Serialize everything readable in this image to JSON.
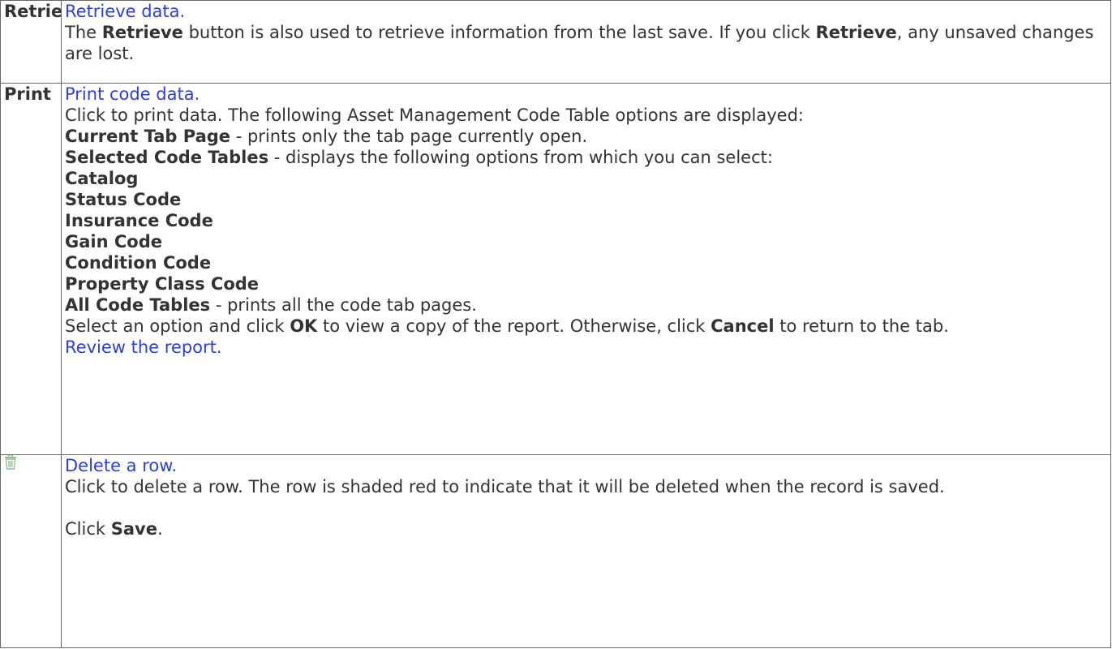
{
  "rows": [
    {
      "label": "Retrieve",
      "link": "Retrieve data.",
      "desc_before": "The ",
      "desc_bold": "Retrieve",
      "desc_mid": " button is also used to retrieve information from the last save. If you click ",
      "desc_bold2": "Retrieve",
      "desc_after": ", any unsaved changes are lost."
    },
    {
      "label": "Print",
      "link": "Print code data.",
      "intro": "Click to print data. The following Asset Management Code Table options are displayed:",
      "opt1_bold": "Current Tab Page",
      "opt1_text": " - prints only the tab page currently open.",
      "opt2_bold": "Selected Code Tables",
      "opt2_text": " - displays the following options from which you can select:",
      "tables": [
        "Catalog",
        "Status Code",
        "Insurance Code",
        "Gain Code",
        "Condition Code",
        "Property Class Code"
      ],
      "opt3_bold": "All Code Tables",
      "opt3_text": " - prints all the code tab pages.",
      "select_before": "Select an option and click ",
      "select_ok": "OK",
      "select_mid": " to view a copy of the report. Otherwise, click ",
      "select_cancel": "Cancel",
      "select_after": " to return to the tab.",
      "review_link": "Review the report."
    },
    {
      "icon": "trash-icon",
      "link": "Delete a row.",
      "desc": "Click to delete a row. The row is shaded red to indicate that it will be deleted when the record is saved.",
      "save_before": "Click ",
      "save_bold": "Save",
      "save_after": "."
    }
  ],
  "colors": {
    "link": "#2b3fe0",
    "text": "#333333",
    "border": "#666666",
    "icon": "#8fbf8f"
  }
}
